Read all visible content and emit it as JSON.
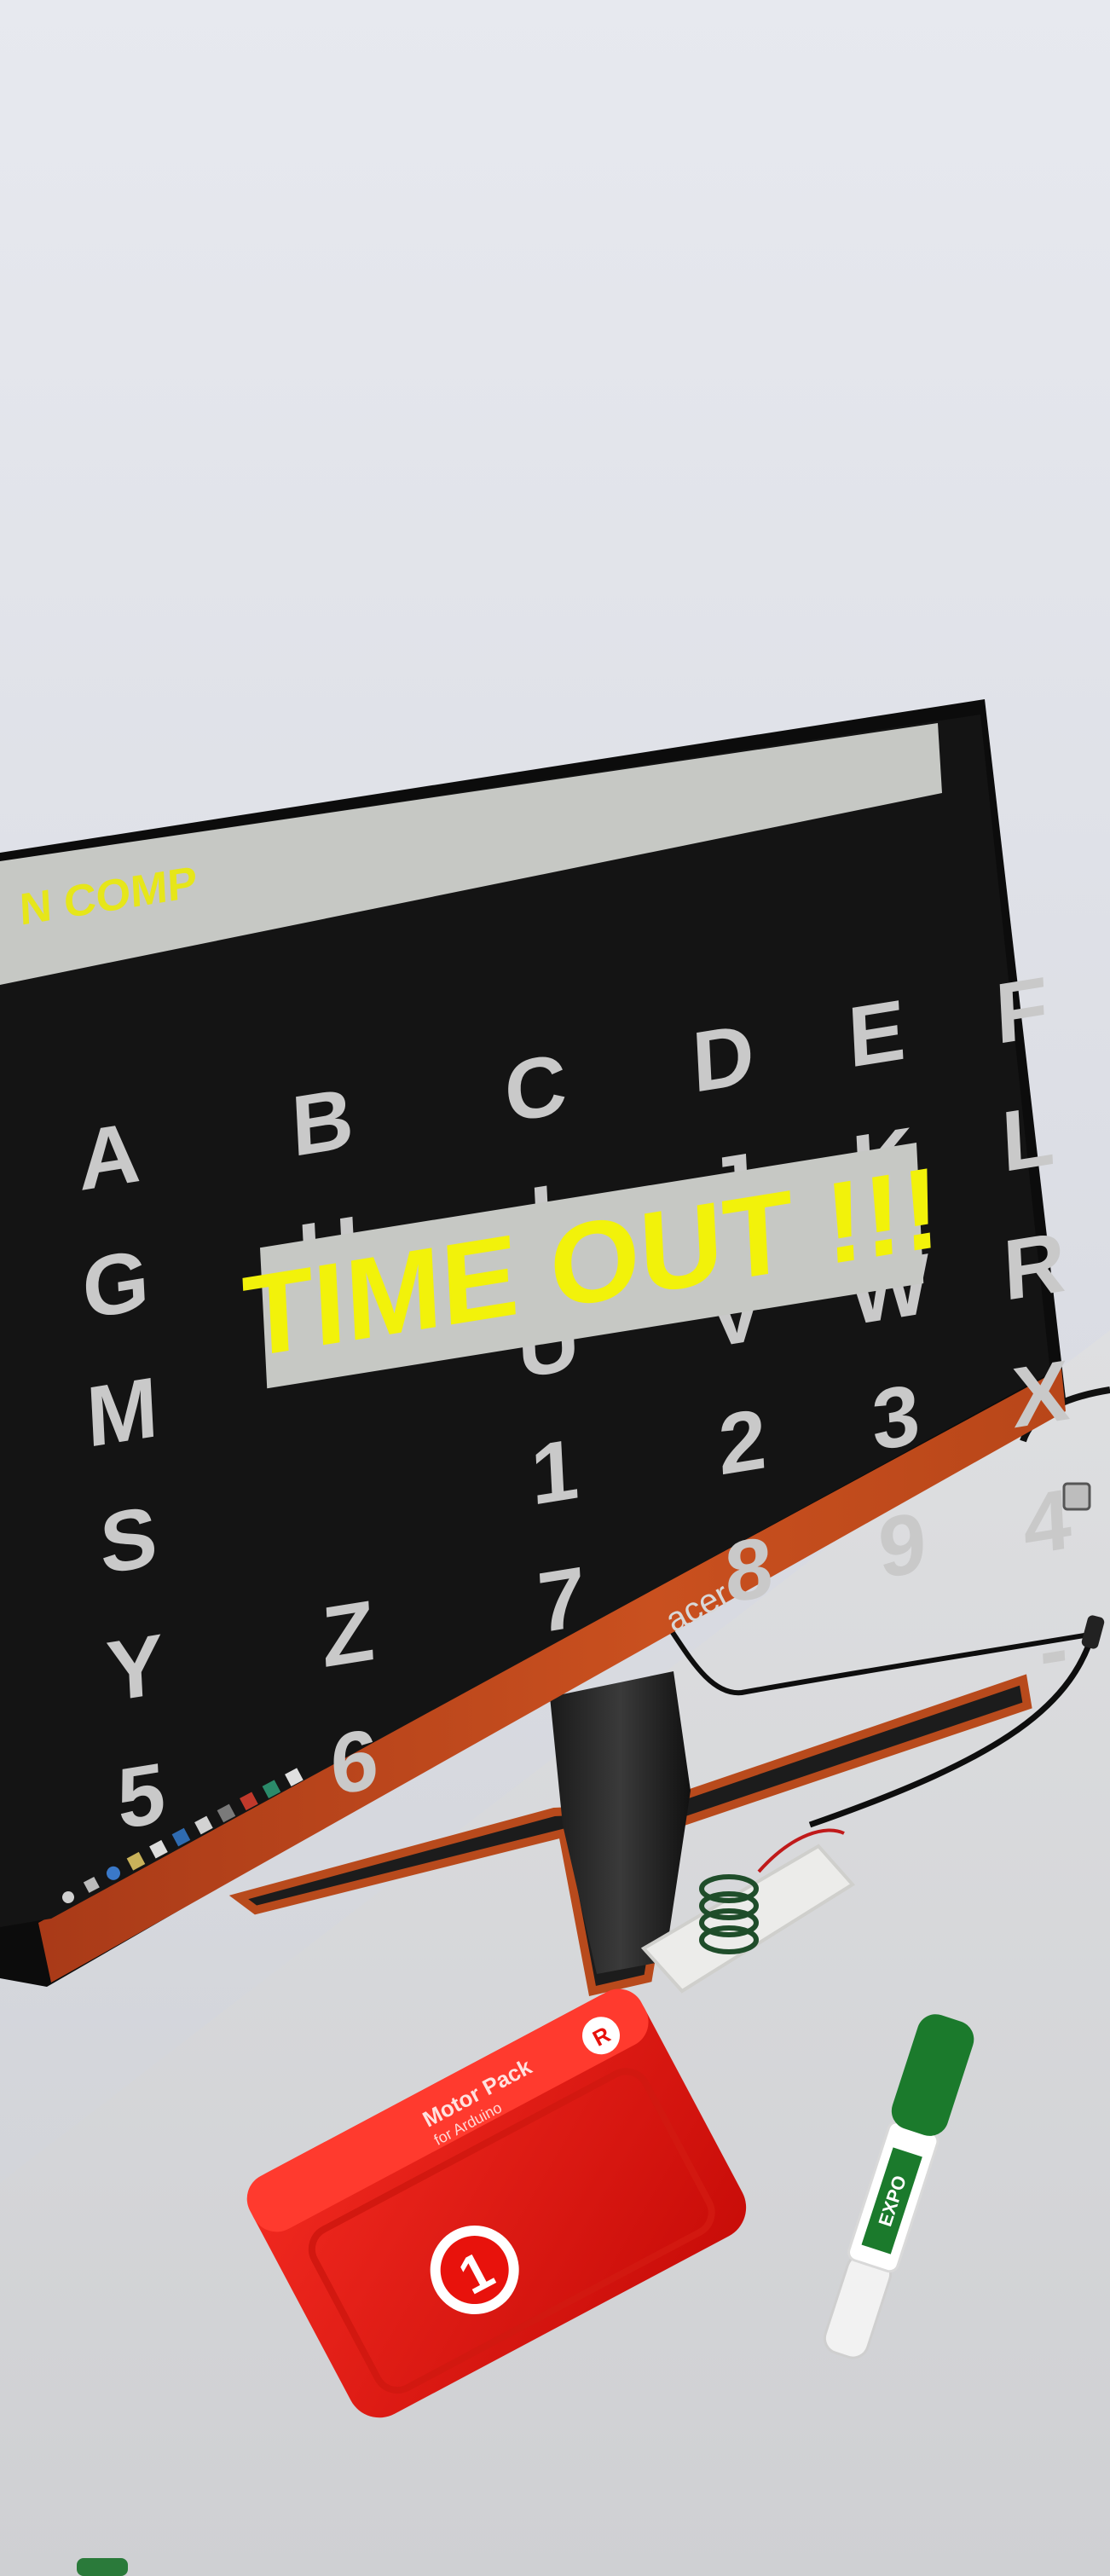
{
  "screen": {
    "banner_text": "N COMP",
    "overlay_text": "TIME OUT !!!",
    "grid_letters": [
      "A",
      "B",
      "C",
      "D",
      "E",
      "F",
      "G",
      "H",
      "I",
      "J",
      "K",
      "L",
      "M",
      "",
      "U",
      "V",
      "W",
      "R",
      "S",
      "",
      "1",
      "2",
      "3",
      "X",
      "Y",
      "Z",
      "7",
      "8",
      "9",
      "4",
      "5",
      "6",
      "",
      "",
      "",
      "-"
    ],
    "colors": {
      "bg": "#141414",
      "letters": "#c9c9c9",
      "overlay_bg": "#c6c8c4",
      "overlay_text": "#f2f20a",
      "banner_text": "#e6e61a"
    }
  },
  "monitor": {
    "brand": "acer",
    "bezel_color": "#c2461f"
  },
  "motor_pack": {
    "title": "Motor Pack",
    "subtitle": "for Arduino",
    "badge_letter": "R",
    "number": "1",
    "color": "#e8120c"
  },
  "marker": {
    "label": "EXPO",
    "cap_color": "#1b7a2c"
  }
}
